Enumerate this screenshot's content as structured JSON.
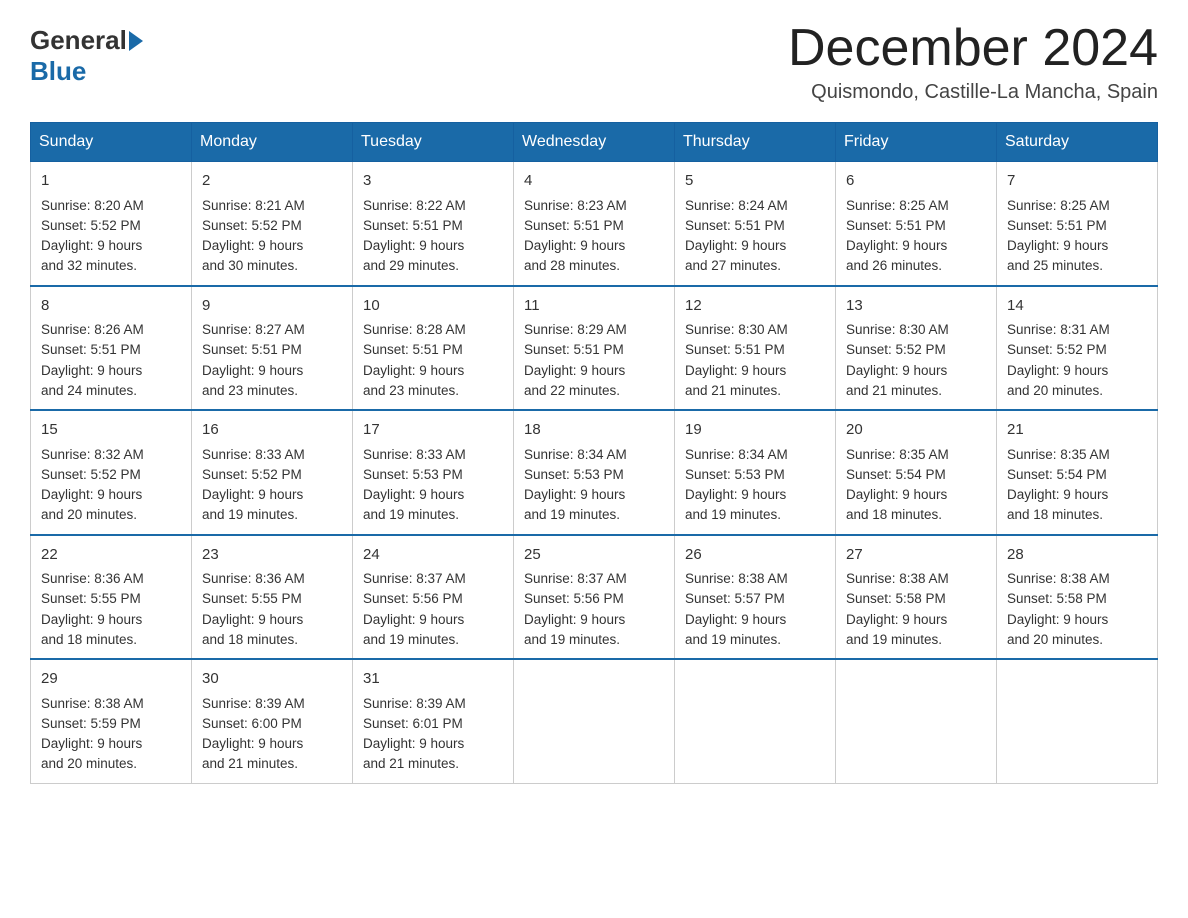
{
  "header": {
    "logo_general": "General",
    "logo_blue": "Blue",
    "month_title": "December 2024",
    "location": "Quismondo, Castille-La Mancha, Spain"
  },
  "weekdays": [
    "Sunday",
    "Monday",
    "Tuesday",
    "Wednesday",
    "Thursday",
    "Friday",
    "Saturday"
  ],
  "weeks": [
    [
      {
        "day": "1",
        "sunrise": "Sunrise: 8:20 AM",
        "sunset": "Sunset: 5:52 PM",
        "daylight": "Daylight: 9 hours",
        "daylight2": "and 32 minutes."
      },
      {
        "day": "2",
        "sunrise": "Sunrise: 8:21 AM",
        "sunset": "Sunset: 5:52 PM",
        "daylight": "Daylight: 9 hours",
        "daylight2": "and 30 minutes."
      },
      {
        "day": "3",
        "sunrise": "Sunrise: 8:22 AM",
        "sunset": "Sunset: 5:51 PM",
        "daylight": "Daylight: 9 hours",
        "daylight2": "and 29 minutes."
      },
      {
        "day": "4",
        "sunrise": "Sunrise: 8:23 AM",
        "sunset": "Sunset: 5:51 PM",
        "daylight": "Daylight: 9 hours",
        "daylight2": "and 28 minutes."
      },
      {
        "day": "5",
        "sunrise": "Sunrise: 8:24 AM",
        "sunset": "Sunset: 5:51 PM",
        "daylight": "Daylight: 9 hours",
        "daylight2": "and 27 minutes."
      },
      {
        "day": "6",
        "sunrise": "Sunrise: 8:25 AM",
        "sunset": "Sunset: 5:51 PM",
        "daylight": "Daylight: 9 hours",
        "daylight2": "and 26 minutes."
      },
      {
        "day": "7",
        "sunrise": "Sunrise: 8:25 AM",
        "sunset": "Sunset: 5:51 PM",
        "daylight": "Daylight: 9 hours",
        "daylight2": "and 25 minutes."
      }
    ],
    [
      {
        "day": "8",
        "sunrise": "Sunrise: 8:26 AM",
        "sunset": "Sunset: 5:51 PM",
        "daylight": "Daylight: 9 hours",
        "daylight2": "and 24 minutes."
      },
      {
        "day": "9",
        "sunrise": "Sunrise: 8:27 AM",
        "sunset": "Sunset: 5:51 PM",
        "daylight": "Daylight: 9 hours",
        "daylight2": "and 23 minutes."
      },
      {
        "day": "10",
        "sunrise": "Sunrise: 8:28 AM",
        "sunset": "Sunset: 5:51 PM",
        "daylight": "Daylight: 9 hours",
        "daylight2": "and 23 minutes."
      },
      {
        "day": "11",
        "sunrise": "Sunrise: 8:29 AM",
        "sunset": "Sunset: 5:51 PM",
        "daylight": "Daylight: 9 hours",
        "daylight2": "and 22 minutes."
      },
      {
        "day": "12",
        "sunrise": "Sunrise: 8:30 AM",
        "sunset": "Sunset: 5:51 PM",
        "daylight": "Daylight: 9 hours",
        "daylight2": "and 21 minutes."
      },
      {
        "day": "13",
        "sunrise": "Sunrise: 8:30 AM",
        "sunset": "Sunset: 5:52 PM",
        "daylight": "Daylight: 9 hours",
        "daylight2": "and 21 minutes."
      },
      {
        "day": "14",
        "sunrise": "Sunrise: 8:31 AM",
        "sunset": "Sunset: 5:52 PM",
        "daylight": "Daylight: 9 hours",
        "daylight2": "and 20 minutes."
      }
    ],
    [
      {
        "day": "15",
        "sunrise": "Sunrise: 8:32 AM",
        "sunset": "Sunset: 5:52 PM",
        "daylight": "Daylight: 9 hours",
        "daylight2": "and 20 minutes."
      },
      {
        "day": "16",
        "sunrise": "Sunrise: 8:33 AM",
        "sunset": "Sunset: 5:52 PM",
        "daylight": "Daylight: 9 hours",
        "daylight2": "and 19 minutes."
      },
      {
        "day": "17",
        "sunrise": "Sunrise: 8:33 AM",
        "sunset": "Sunset: 5:53 PM",
        "daylight": "Daylight: 9 hours",
        "daylight2": "and 19 minutes."
      },
      {
        "day": "18",
        "sunrise": "Sunrise: 8:34 AM",
        "sunset": "Sunset: 5:53 PM",
        "daylight": "Daylight: 9 hours",
        "daylight2": "and 19 minutes."
      },
      {
        "day": "19",
        "sunrise": "Sunrise: 8:34 AM",
        "sunset": "Sunset: 5:53 PM",
        "daylight": "Daylight: 9 hours",
        "daylight2": "and 19 minutes."
      },
      {
        "day": "20",
        "sunrise": "Sunrise: 8:35 AM",
        "sunset": "Sunset: 5:54 PM",
        "daylight": "Daylight: 9 hours",
        "daylight2": "and 18 minutes."
      },
      {
        "day": "21",
        "sunrise": "Sunrise: 8:35 AM",
        "sunset": "Sunset: 5:54 PM",
        "daylight": "Daylight: 9 hours",
        "daylight2": "and 18 minutes."
      }
    ],
    [
      {
        "day": "22",
        "sunrise": "Sunrise: 8:36 AM",
        "sunset": "Sunset: 5:55 PM",
        "daylight": "Daylight: 9 hours",
        "daylight2": "and 18 minutes."
      },
      {
        "day": "23",
        "sunrise": "Sunrise: 8:36 AM",
        "sunset": "Sunset: 5:55 PM",
        "daylight": "Daylight: 9 hours",
        "daylight2": "and 18 minutes."
      },
      {
        "day": "24",
        "sunrise": "Sunrise: 8:37 AM",
        "sunset": "Sunset: 5:56 PM",
        "daylight": "Daylight: 9 hours",
        "daylight2": "and 19 minutes."
      },
      {
        "day": "25",
        "sunrise": "Sunrise: 8:37 AM",
        "sunset": "Sunset: 5:56 PM",
        "daylight": "Daylight: 9 hours",
        "daylight2": "and 19 minutes."
      },
      {
        "day": "26",
        "sunrise": "Sunrise: 8:38 AM",
        "sunset": "Sunset: 5:57 PM",
        "daylight": "Daylight: 9 hours",
        "daylight2": "and 19 minutes."
      },
      {
        "day": "27",
        "sunrise": "Sunrise: 8:38 AM",
        "sunset": "Sunset: 5:58 PM",
        "daylight": "Daylight: 9 hours",
        "daylight2": "and 19 minutes."
      },
      {
        "day": "28",
        "sunrise": "Sunrise: 8:38 AM",
        "sunset": "Sunset: 5:58 PM",
        "daylight": "Daylight: 9 hours",
        "daylight2": "and 20 minutes."
      }
    ],
    [
      {
        "day": "29",
        "sunrise": "Sunrise: 8:38 AM",
        "sunset": "Sunset: 5:59 PM",
        "daylight": "Daylight: 9 hours",
        "daylight2": "and 20 minutes."
      },
      {
        "day": "30",
        "sunrise": "Sunrise: 8:39 AM",
        "sunset": "Sunset: 6:00 PM",
        "daylight": "Daylight: 9 hours",
        "daylight2": "and 21 minutes."
      },
      {
        "day": "31",
        "sunrise": "Sunrise: 8:39 AM",
        "sunset": "Sunset: 6:01 PM",
        "daylight": "Daylight: 9 hours",
        "daylight2": "and 21 minutes."
      },
      null,
      null,
      null,
      null
    ]
  ]
}
